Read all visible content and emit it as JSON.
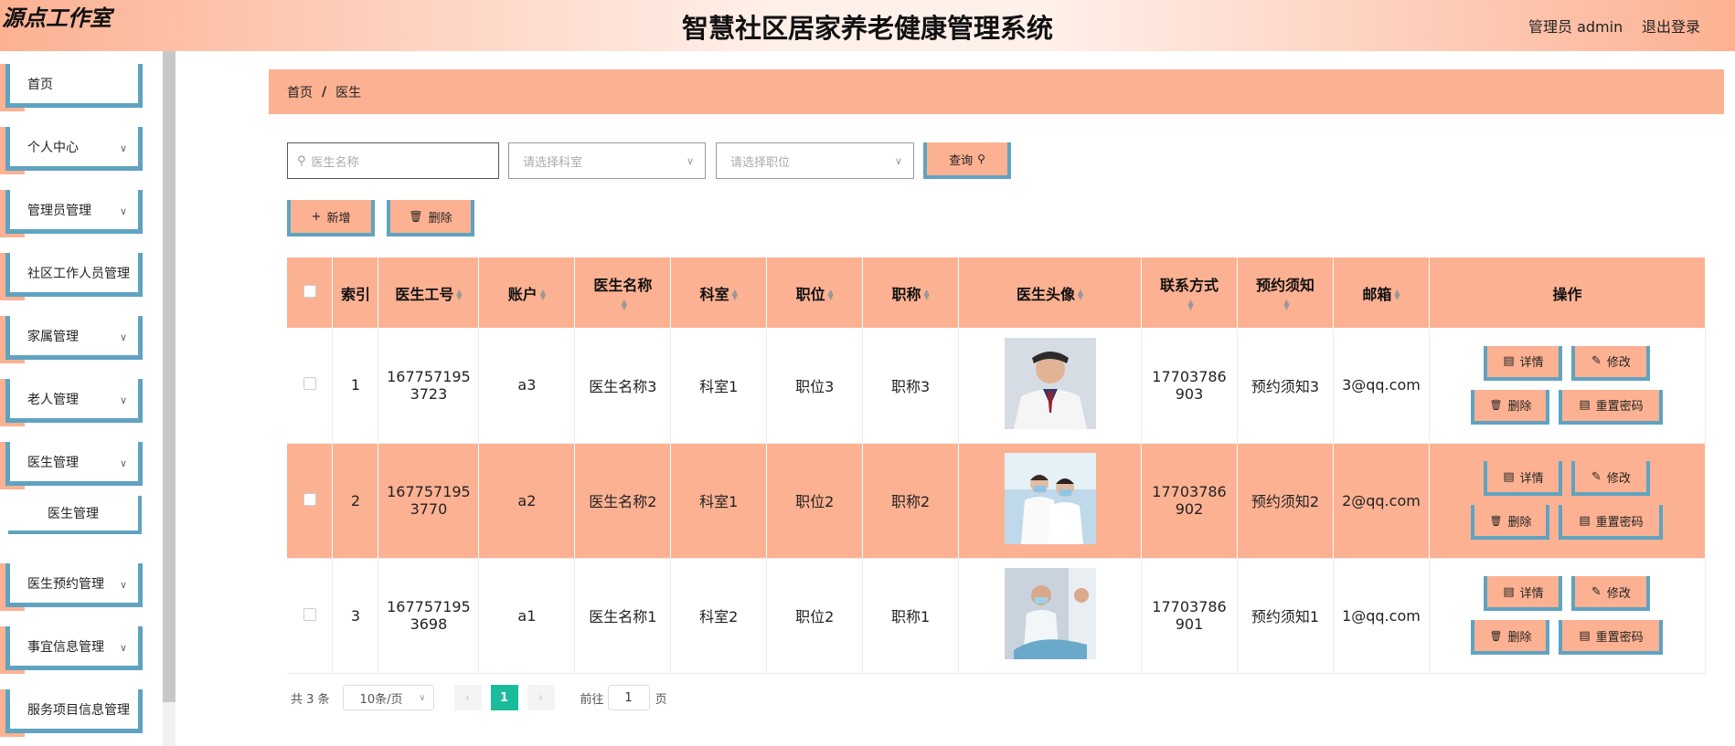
{
  "header": {
    "logo": "源点工作室",
    "title": "智慧社区居家养老健康管理系统",
    "user": "管理员 admin",
    "logout": "退出登录"
  },
  "sidebar": {
    "items": [
      {
        "label": "首页",
        "has_children": false
      },
      {
        "label": "个人中心",
        "has_children": true
      },
      {
        "label": "管理员管理",
        "has_children": true
      },
      {
        "label": "社区工作人员管理",
        "has_children": false
      },
      {
        "label": "家属管理",
        "has_children": true
      },
      {
        "label": "老人管理",
        "has_children": true
      },
      {
        "label": "医生管理",
        "has_children": true
      },
      {
        "label": "医生管理",
        "sub": true
      },
      {
        "label": "医生预约管理",
        "has_children": true
      },
      {
        "label": "事宜信息管理",
        "has_children": true
      },
      {
        "label": "服务项目信息管理",
        "has_children": false
      }
    ]
  },
  "breadcrumb": {
    "home": "首页",
    "sep": "/",
    "current": "医生"
  },
  "search": {
    "name_placeholder": "医生名称",
    "dept_placeholder": "请选择科室",
    "position_placeholder": "请选择职位",
    "query_label": "查询"
  },
  "actions": {
    "add_label": "新增",
    "delete_label": "删除"
  },
  "table": {
    "headers": [
      "索引",
      "医生工号",
      "账户",
      "医生名称",
      "科室",
      "职位",
      "职称",
      "医生头像",
      "联系方式",
      "预约须知",
      "邮箱",
      "操作"
    ],
    "rows": [
      {
        "index": "1",
        "id_l1": "167757195",
        "id_l2": "3723",
        "account": "a3",
        "name": "医生名称3",
        "dept": "科室1",
        "position": "职位3",
        "title": "职称3",
        "phone_l1": "17703786",
        "phone_l2": "903",
        "notice": "预约须知3",
        "email": "3@qq.com"
      },
      {
        "index": "2",
        "id_l1": "167757195",
        "id_l2": "3770",
        "account": "a2",
        "name": "医生名称2",
        "dept": "科室1",
        "position": "职位2",
        "title": "职称2",
        "phone_l1": "17703786",
        "phone_l2": "902",
        "notice": "预约须知2",
        "email": "2@qq.com"
      },
      {
        "index": "3",
        "id_l1": "167757195",
        "id_l2": "3698",
        "account": "a1",
        "name": "医生名称1",
        "dept": "科室2",
        "position": "职位2",
        "title": "职称1",
        "phone_l1": "17703786",
        "phone_l2": "901",
        "notice": "预约须知1",
        "email": "1@qq.com"
      }
    ],
    "op_labels": {
      "detail": "详情",
      "edit": "修改",
      "delete": "删除",
      "reset": "重置密码"
    }
  },
  "pager": {
    "total": "共 3 条",
    "page_size": "10条/页",
    "current": "1",
    "goto_prefix": "前往",
    "goto_value": "1",
    "goto_suffix": "页"
  },
  "colors": {
    "accent": "#fcb192",
    "border_accent": "#5fa3c1",
    "pager_active": "#1abc9c"
  }
}
